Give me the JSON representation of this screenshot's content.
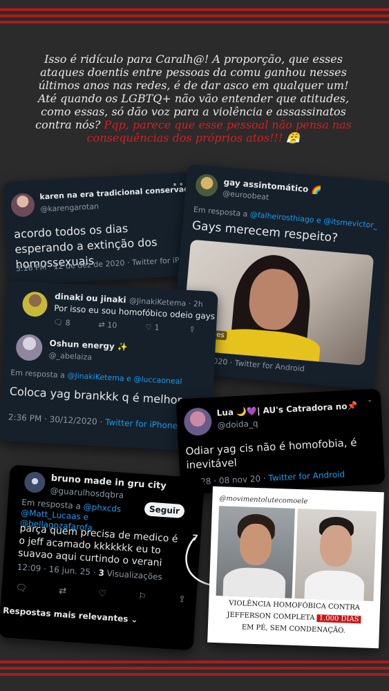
{
  "caption": {
    "main": "Isso é ridículo para Caralh@! A proporção, que esses ataques doentis entre pessoas da comu ganhou nesses últimos anos nas redes, é de dar asco em qualquer um! Até quando os LGBTQ+ não vão entender que atitudes, como essas, só dão voz para a violência e assassinatos contra nós?",
    "highlight": "Pqp, parece que esse pessoal não pensa nas consequências dos próprios atos!!!",
    "emoji": "😤"
  },
  "tweet_karen": {
    "name": "karen na era tradicional conservadora",
    "handle": "@karengarotan",
    "text": "acordo todos os dias esperando a extinção dos homossexuais",
    "time": "3:16 PM · 12 de dez de 2020 · ",
    "source": "Twitter for iPhone"
  },
  "tweet_gay": {
    "name": "gay assintomático 🌈",
    "handle": "@euroobeat",
    "reply_prefix": "Em resposta a ",
    "reply_to": "@falheirosthiago e @itsmevictor_",
    "text": "Gays merecem respeito?",
    "image_overlay": "ualizações",
    "time": " dez de 2020 · ",
    "source": "Twitter for Android"
  },
  "tweet_dinaki": {
    "name": "dinaki ou jinaki",
    "handle": "@JinakiKetema · 2h",
    "text": "Por isso eu sou homofóbico odeio gays",
    "replies": "8",
    "retweets": "10",
    "likes": "1"
  },
  "tweet_oshun": {
    "name": "Oshun energy ✨",
    "handle": "@_abelaiza",
    "reply_prefix": "Em resposta a ",
    "reply_to": "@JinakiKetema e @luccaoneal",
    "text": "Coloca yag brankkk q é melhor",
    "time": "2:36 PM · 30/12/2020 · ",
    "source": "Twitter for iPhone"
  },
  "tweet_lua": {
    "name": "Lua 🌙💜| AU's Catradora no📌",
    "handle": "@doida_q",
    "text": "Odiar yag cis não é homofobia, é inevitável",
    "time": "19:28 · 08 nov 20 · ",
    "source": "Twitter for Android"
  },
  "tweet_bruno": {
    "name": "bruno made in gru city",
    "handle": "@guarulhosdqbra",
    "follow_label": "Seguir",
    "reply_prefix": "Em resposta a ",
    "reply_to": "@phxcds @Matt_Lucaas e @bellagozafarofa",
    "text": "parça quem precisa de medico é o jeff acamado kkkkkkk eu to suavao aqui curtindo o verani",
    "time": "12:09 · 16 jun. 25 · ",
    "views_count": "3",
    "views_label": " Visualizações",
    "sort_label": "Respostas mais relevantes",
    "side_number": "7"
  },
  "photo": {
    "watermark": "@movimentolutecomoele",
    "headline_1": "VIOLÊNCIA HOMOFÓBICA CONTRA",
    "headline_2": "JEFFERSON COMPLETA",
    "headline_days": "1.000 DIAS",
    "headline_3": "EM PÉ, SEM CONDENAÇÃO."
  },
  "colors": {
    "stripe": "#b3191c",
    "twitter_blue": "#1d9bf0",
    "caption_red": "#d61f1f",
    "dim_card": "#15202b"
  }
}
